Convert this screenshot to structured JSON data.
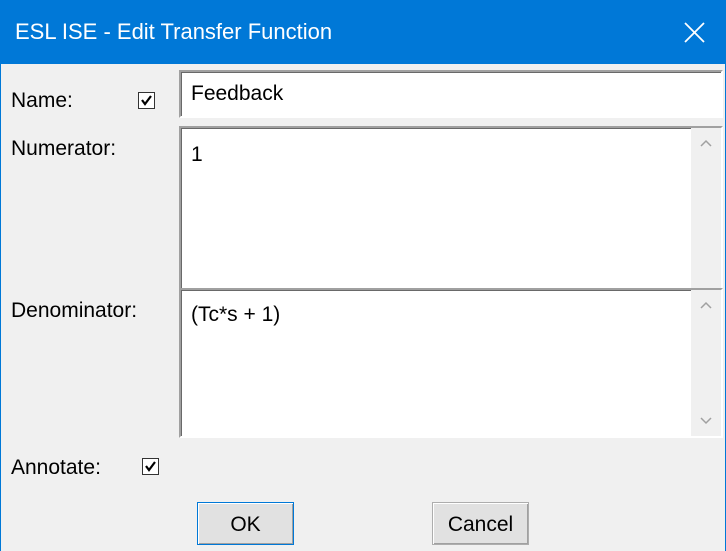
{
  "window": {
    "title": "ESL ISE - Edit Transfer Function",
    "close_icon": "close-icon"
  },
  "form": {
    "name_label": "Name:",
    "name_checked": true,
    "name_value": "Feedback",
    "numerator_label": "Numerator:",
    "numerator_value": "1",
    "denominator_label": "Denominator:",
    "denominator_value": "(Tc*s + 1)",
    "annotate_label": "Annotate:",
    "annotate_checked": true
  },
  "buttons": {
    "ok_label": "OK",
    "cancel_label": "Cancel"
  },
  "colors": {
    "titlebar": "#0078d7",
    "dialog_bg": "#f0f0f0",
    "field_bg": "#ffffff"
  }
}
